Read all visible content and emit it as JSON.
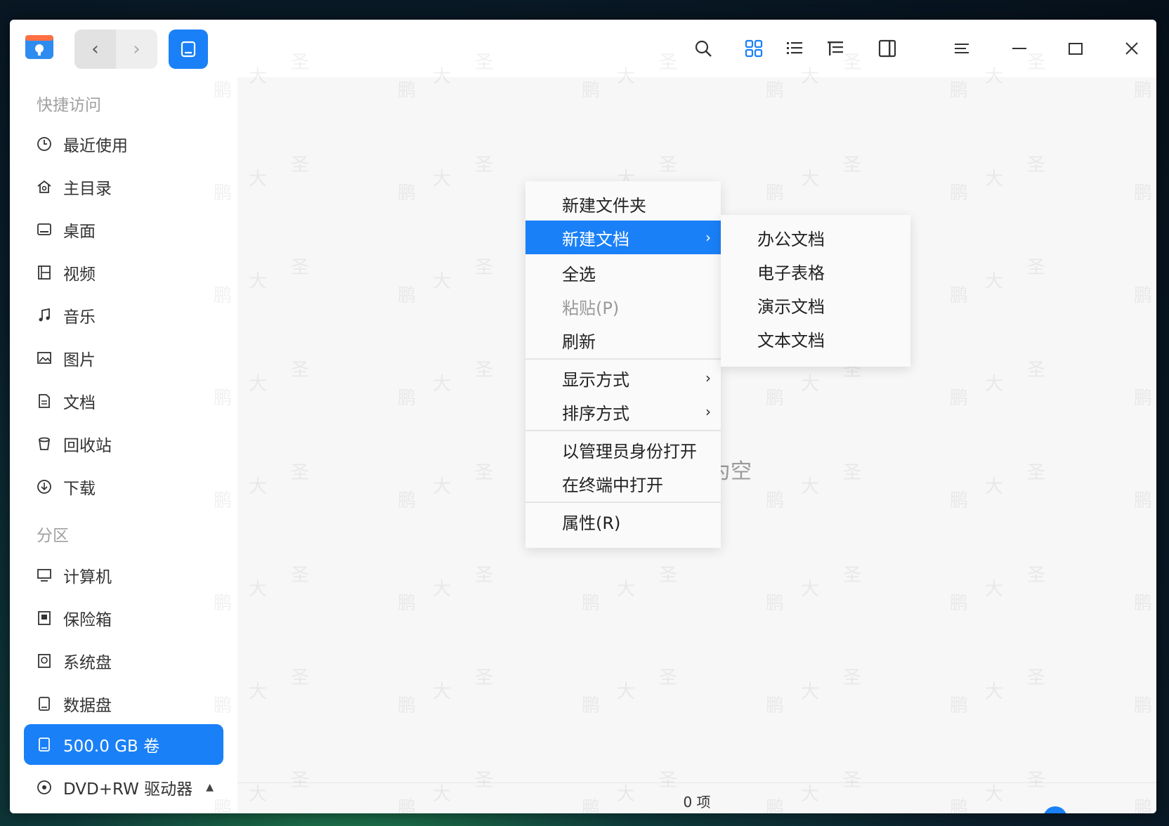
{
  "titlebar": {
    "nav_back": "‹",
    "nav_forward": "›"
  },
  "sidebar": {
    "quick_access_label": "快捷访问",
    "quick_items": [
      {
        "label": "最近使用",
        "icon": "clock-icon"
      },
      {
        "label": "主目录",
        "icon": "home-icon"
      },
      {
        "label": "桌面",
        "icon": "desktop-icon"
      },
      {
        "label": "视频",
        "icon": "video-icon"
      },
      {
        "label": "音乐",
        "icon": "music-icon"
      },
      {
        "label": "图片",
        "icon": "picture-icon"
      },
      {
        "label": "文档",
        "icon": "document-icon"
      },
      {
        "label": "回收站",
        "icon": "trash-icon"
      },
      {
        "label": "下载",
        "icon": "download-icon"
      }
    ],
    "partition_label": "分区",
    "partition_items": [
      {
        "label": "计算机",
        "icon": "computer-icon"
      },
      {
        "label": "保险箱",
        "icon": "vault-icon"
      },
      {
        "label": "系统盘",
        "icon": "system-disk-icon"
      },
      {
        "label": "数据盘",
        "icon": "data-disk-icon"
      },
      {
        "label": "500.0 GB 卷",
        "icon": "volume-icon",
        "active": true
      },
      {
        "label": "DVD+RW 驱动器",
        "icon": "dvd-icon",
        "eject": "▲"
      }
    ]
  },
  "content": {
    "empty_text": "为空"
  },
  "context_menu": {
    "items": [
      {
        "label": "新建文件夹"
      },
      {
        "label": "新建文档",
        "arrow": "›",
        "highlighted": true
      },
      {
        "label": "全选"
      },
      {
        "label": "粘贴(P)",
        "disabled": true
      },
      {
        "label": "刷新"
      },
      {
        "label": "显示方式",
        "arrow": "›"
      },
      {
        "label": "排序方式",
        "arrow": "›"
      },
      {
        "label": "以管理员身份打开"
      },
      {
        "label": "在终端中打开"
      },
      {
        "label": "属性(R)"
      }
    ]
  },
  "submenu": {
    "items": [
      {
        "label": "办公文档"
      },
      {
        "label": "电子表格"
      },
      {
        "label": "演示文档"
      },
      {
        "label": "文本文档"
      }
    ]
  },
  "status": {
    "item_count": "0 项",
    "icon_size_level": 0.05
  },
  "colors": {
    "accent": "#1a80f7"
  },
  "watermark": {
    "chars": [
      "鹏",
      "大",
      "圣"
    ]
  }
}
